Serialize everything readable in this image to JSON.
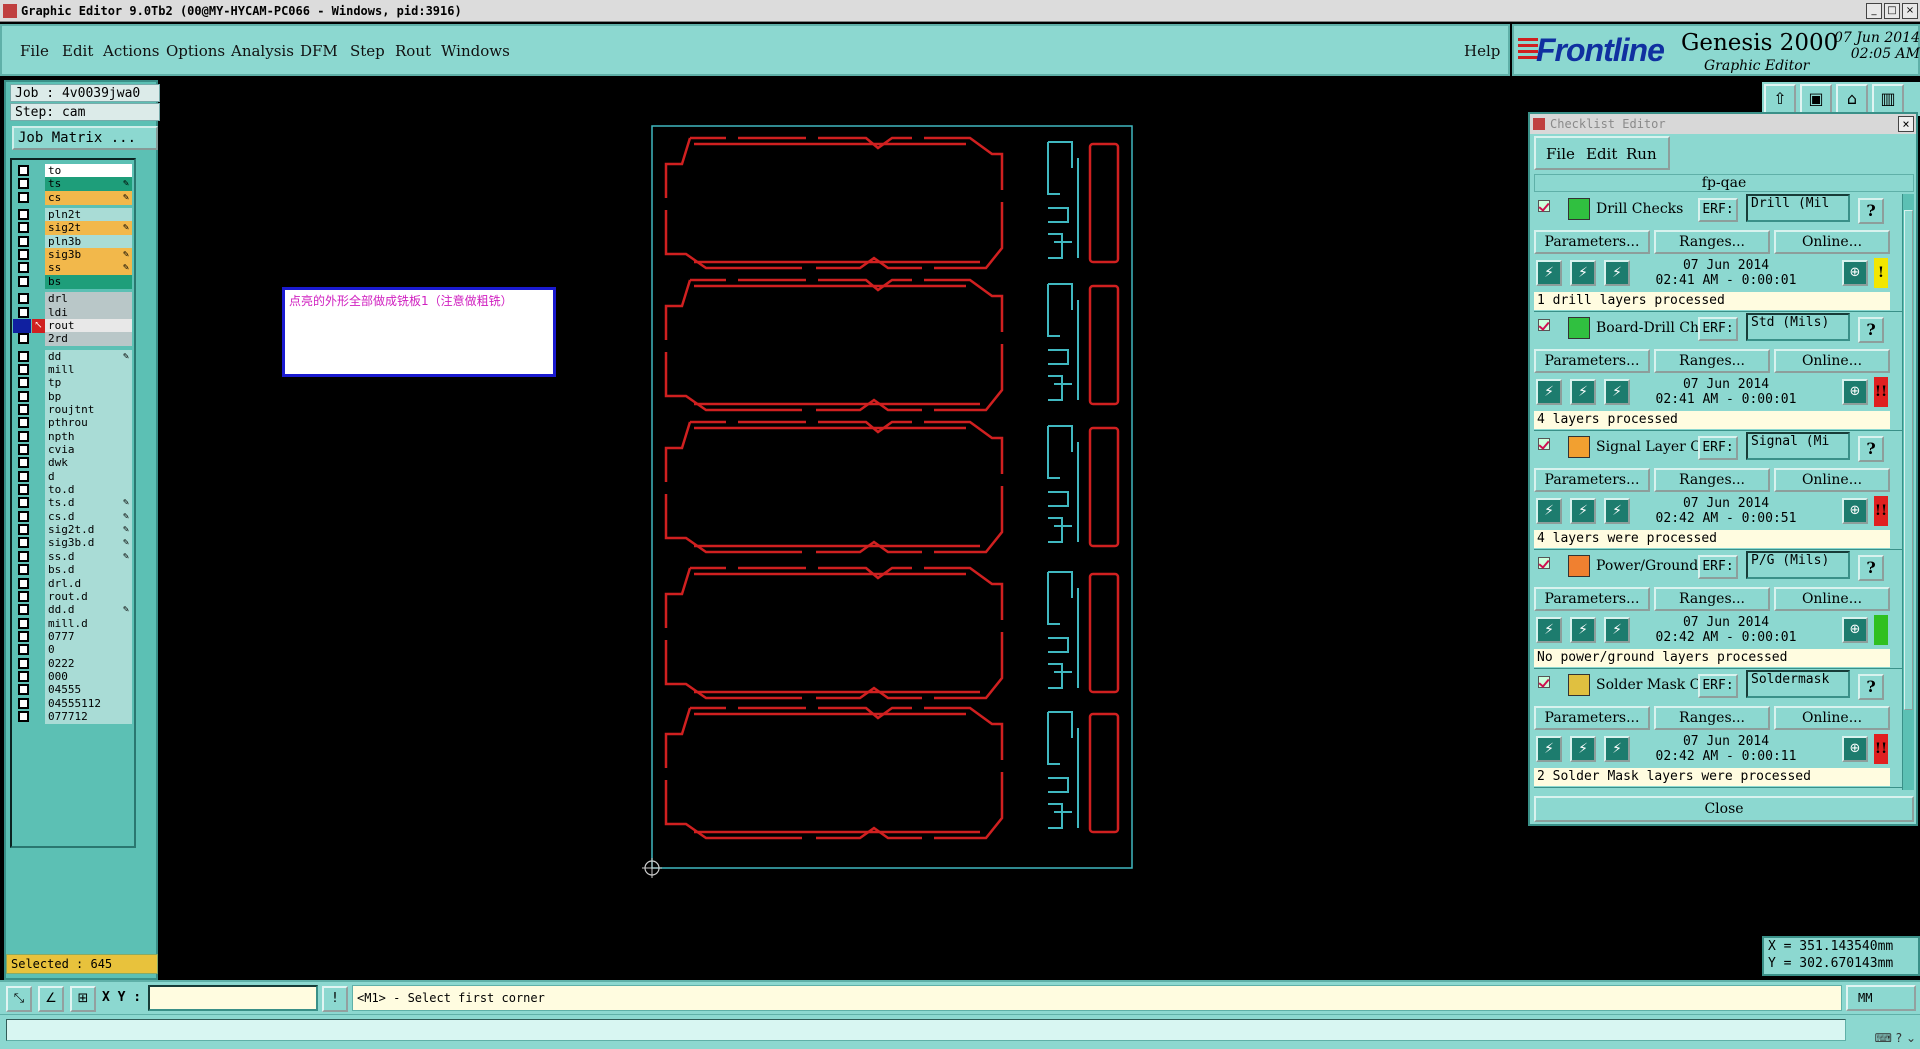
{
  "window": {
    "title": "Graphic Editor 9.0Tb2 (00@MY-HYCAM-PC066 - Windows, pid:3916)",
    "controls": [
      "_",
      "□",
      "×"
    ]
  },
  "menu": {
    "items": [
      "File",
      "Edit",
      "Actions",
      "Options",
      "Analysis",
      "DFM",
      "Step",
      "Rout",
      "Windows"
    ],
    "help": "Help"
  },
  "brand": {
    "logo": "Frontline",
    "product": "Genesis 2000",
    "subtitle": "Graphic Editor",
    "date": "07 Jun 2014",
    "time": "02:05 AM"
  },
  "job": {
    "job_label": "Job : 4v0039jwa0",
    "step_label": "Step: cam",
    "matrix_button": "Job Matrix ..."
  },
  "layers": [
    {
      "name": "to",
      "color": "#ffffff",
      "editable": false
    },
    {
      "name": "ts",
      "color": "#1e9e7a",
      "editable": true
    },
    {
      "name": "cs",
      "color": "#f2b84b",
      "editable": true
    },
    {
      "name": "pln2t",
      "color": "#a9dcd6",
      "editable": false
    },
    {
      "name": "sig2t",
      "color": "#f2b84b",
      "editable": true
    },
    {
      "name": "pln3b",
      "color": "#a9dcd6",
      "editable": false
    },
    {
      "name": "sig3b",
      "color": "#f2b84b",
      "editable": true
    },
    {
      "name": "ss",
      "color": "#f2b84b",
      "editable": true
    },
    {
      "name": "bs",
      "color": "#1e9e7a",
      "editable": false
    },
    {
      "name": "drl",
      "color": "#b9c7c8",
      "editable": false
    },
    {
      "name": "ldi",
      "color": "#b9c7c8",
      "editable": false
    },
    {
      "name": "rout",
      "color": "#e8e8e8",
      "editable": false,
      "active": true
    },
    {
      "name": "2rd",
      "color": "#b9c7c8",
      "editable": false
    },
    {
      "name": "dd",
      "color": "#a9dcd6",
      "editable": true
    },
    {
      "name": "mill",
      "color": "#a9dcd6",
      "editable": false
    },
    {
      "name": "tp",
      "color": "#a9dcd6",
      "editable": false
    },
    {
      "name": "bp",
      "color": "#a9dcd6",
      "editable": false
    },
    {
      "name": "roujtnt",
      "color": "#a9dcd6",
      "editable": false
    },
    {
      "name": "pthrou",
      "color": "#a9dcd6",
      "editable": false
    },
    {
      "name": "npth",
      "color": "#a9dcd6",
      "editable": false
    },
    {
      "name": "cvia",
      "color": "#a9dcd6",
      "editable": false
    },
    {
      "name": "dwk",
      "color": "#a9dcd6",
      "editable": false
    },
    {
      "name": "d",
      "color": "#a9dcd6",
      "editable": false
    },
    {
      "name": "to.d",
      "color": "#a9dcd6",
      "editable": false
    },
    {
      "name": "ts.d",
      "color": "#a9dcd6",
      "editable": true
    },
    {
      "name": "cs.d",
      "color": "#a9dcd6",
      "editable": true
    },
    {
      "name": "sig2t.d",
      "color": "#a9dcd6",
      "editable": true
    },
    {
      "name": "sig3b.d",
      "color": "#a9dcd6",
      "editable": true
    },
    {
      "name": "ss.d",
      "color": "#a9dcd6",
      "editable": true
    },
    {
      "name": "bs.d",
      "color": "#a9dcd6",
      "editable": false
    },
    {
      "name": "drl.d",
      "color": "#a9dcd6",
      "editable": false
    },
    {
      "name": "rout.d",
      "color": "#a9dcd6",
      "editable": false
    },
    {
      "name": "dd.d",
      "color": "#a9dcd6",
      "editable": true
    },
    {
      "name": "mill.d",
      "color": "#a9dcd6",
      "editable": false
    },
    {
      "name": "0777",
      "color": "#a9dcd6",
      "editable": false
    },
    {
      "name": "0",
      "color": "#a9dcd6",
      "editable": false
    },
    {
      "name": "0222",
      "color": "#a9dcd6",
      "editable": false
    },
    {
      "name": "000",
      "color": "#a9dcd6",
      "editable": false
    },
    {
      "name": "04555",
      "color": "#a9dcd6",
      "editable": false
    },
    {
      "name": "04555112",
      "color": "#a9dcd6",
      "editable": false
    },
    {
      "name": "077712",
      "color": "#a9dcd6",
      "editable": false
    }
  ],
  "selected": "Selected : 645",
  "note": "点亮的外形全部做成铣板1（注意做粗铣）",
  "coords": {
    "x": "X = 351.143540mm",
    "y": "Y = 302.670143mm"
  },
  "checklist": {
    "title": "Checklist Editor",
    "menu": [
      "File",
      "Edit",
      "Run"
    ],
    "name": "fp-qae",
    "erf_label": "ERF:",
    "params_label": "Parameters...",
    "ranges_label": "Ranges...",
    "online_label": "Online...",
    "close_label": "Close",
    "items": [
      {
        "name": "Drill Checks",
        "erf": "Drill (Mil",
        "date": "07 Jun 2014",
        "time": "02:41 AM - 0:00:01",
        "result": "1 drill layers processed",
        "status": "!",
        "status_color": "#f2e600",
        "icon_color": "#30c040"
      },
      {
        "name": "Board-Drill Checks",
        "erf": "Std (Mils)",
        "date": "07 Jun 2014",
        "time": "02:41 AM - 0:00:01",
        "result": "4 layers processed",
        "status": "!!",
        "status_color": "#e02020",
        "icon_color": "#30c040"
      },
      {
        "name": "Signal Layer Checks",
        "erf": "Signal (Mi",
        "date": "07 Jun 2014",
        "time": "02:42 AM - 0:00:51",
        "result": "4 layers were processed",
        "status": "!!",
        "status_color": "#e02020",
        "icon_color": "#f2a030"
      },
      {
        "name": "Power/Ground Checks",
        "erf": "P/G (Mils)",
        "date": "07 Jun 2014",
        "time": "02:42 AM - 0:00:01",
        "result": "No power/ground layers processed",
        "status": "",
        "status_color": "#30c020",
        "icon_color": "#f08030"
      },
      {
        "name": "Solder Mask Checks",
        "erf": "Soldermask",
        "date": "07 Jun 2014",
        "time": "02:42 AM - 0:00:11",
        "result": "2 Solder Mask layers were processed",
        "status": "!!",
        "status_color": "#e02020",
        "icon_color": "#e0c040"
      }
    ]
  },
  "statusbar": {
    "xy_label": "X Y :",
    "xy_value": "",
    "prompt": "<M1> - Select first corner",
    "units": "MM"
  },
  "colors": {
    "panel": "#8cd8d0",
    "rout_outline": "#d02020",
    "profile_outline": "#40b8c0"
  }
}
